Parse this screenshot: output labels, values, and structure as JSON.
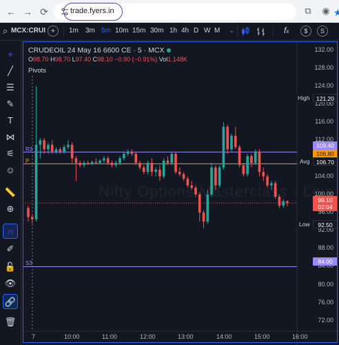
{
  "browser": {
    "back_glyph": "←",
    "forward_glyph": "→",
    "reload_glyph": "⟳",
    "url": "trade.fyers.in",
    "bookmark_icon": "star-icon",
    "extensions_glyph": "⧉",
    "profile_glyph": "◉"
  },
  "toolbar": {
    "search_glyph": "⌕",
    "symbol": "MCX:CRUI",
    "add_glyph": "+",
    "timeframes": [
      "1m",
      "3m",
      "5m",
      "10m",
      "15m",
      "30m",
      "1h",
      "4h",
      "D",
      "W",
      "M"
    ],
    "active_timeframe": "5m",
    "more_glyph": "⌄",
    "indicators_glyph": "f",
    "indicators_label": "x",
    "currency_glyph": "$",
    "settings_glyph": "S"
  },
  "sidebar": {
    "tools": [
      {
        "name": "crosshair-icon",
        "glyph": "+"
      },
      {
        "name": "trendline-icon",
        "glyph": "╱"
      },
      {
        "name": "horizontal-lines-icon",
        "glyph": "☰"
      },
      {
        "name": "brush-icon",
        "glyph": "✎"
      },
      {
        "name": "text-icon",
        "glyph": "T"
      },
      {
        "name": "pattern-icon",
        "glyph": "⋈"
      },
      {
        "name": "prediction-icon",
        "glyph": "⚟"
      },
      {
        "name": "emoji-icon",
        "glyph": "☺"
      },
      {
        "name": "ruler-icon",
        "glyph": "📏"
      },
      {
        "name": "zoom-in-icon",
        "glyph": "⊕"
      },
      {
        "name": "magnet-icon",
        "glyph": "∩"
      },
      {
        "name": "pencil-lock-icon",
        "glyph": "✐"
      },
      {
        "name": "lock-icon",
        "glyph": "🔓"
      },
      {
        "name": "eye-icon",
        "glyph": "👁"
      },
      {
        "name": "link-icon",
        "glyph": "🔗"
      },
      {
        "name": "trash-icon",
        "glyph": "🗑"
      }
    ]
  },
  "chart": {
    "symbol_line": "CRUDEOIL 24 May 16 6600 CE · 5 · MCX",
    "open_label": "O",
    "open": "98.70",
    "high_label": "H",
    "high": "98.70",
    "low_label": "L",
    "low": "97.40",
    "close_label": "C",
    "close": "98.10",
    "change": "−0.90 (−0.91%)",
    "vol_label": "Vol",
    "vol": "1.148K",
    "indicator": "Pivots",
    "watermark": "Nifty Options Masterclass  ·  Live",
    "last_price": "98.10",
    "countdown": "02:04",
    "colors": {
      "up": "#26a69a",
      "down": "#ef5350",
      "pivot_r3": "#9c88ff",
      "pivot_p": "#ff9800",
      "accent": "#2962ff"
    },
    "pivot_r3_label": "R3",
    "pivot_p_label": "P",
    "pivot_s3_label": "S3",
    "levels": {
      "high_label": "High",
      "high_value": "121.20",
      "r3_value": "109.40",
      "p_value": "106.80",
      "avg_label": "Avg",
      "avg_value": "106.70",
      "low_label": "Low",
      "low_value": "92.50",
      "s3_value": "84.00"
    },
    "price_ticks": [
      "132.00",
      "128.00",
      "124.00",
      "120.00",
      "116.00",
      "112.00",
      "108.00",
      "104.00",
      "100.00",
      "96.00",
      "92.00",
      "88.00",
      "84.00",
      "80.00",
      "76.00",
      "72.00"
    ],
    "time_ticks": [
      "7",
      "10:00",
      "11:00",
      "12:00",
      "13:00",
      "14:00",
      "15:00",
      "16:00"
    ]
  },
  "chart_data": {
    "type": "candlestick",
    "y_range": [
      70,
      133
    ],
    "candles": [
      [
        97.0,
        97.5,
        94.0,
        95.0
      ],
      [
        95.0,
        95.5,
        93.5,
        94.5
      ],
      [
        94.5,
        124.0,
        94.0,
        111.0
      ],
      [
        111.0,
        112.5,
        108.0,
        112.0
      ],
      [
        112.0,
        112.5,
        109.0,
        110.0
      ],
      [
        110.0,
        111.5,
        109.0,
        111.0
      ],
      [
        111.0,
        112.0,
        109.0,
        109.5
      ],
      [
        109.5,
        110.5,
        109.0,
        110.0
      ],
      [
        110.0,
        110.5,
        109.0,
        109.5
      ],
      [
        109.5,
        111.0,
        109.0,
        110.5
      ],
      [
        110.5,
        112.0,
        110.0,
        111.0
      ],
      [
        111.0,
        111.5,
        107.0,
        108.0
      ],
      [
        108.0,
        108.5,
        103.0,
        107.0
      ],
      [
        107.0,
        107.5,
        106.0,
        106.5
      ],
      [
        106.5,
        107.5,
        106.0,
        107.0
      ],
      [
        107.0,
        107.5,
        106.5,
        106.8
      ],
      [
        106.8,
        107.5,
        106.5,
        107.2
      ],
      [
        107.2,
        108.0,
        106.8,
        107.0
      ],
      [
        107.0,
        107.8,
        106.8,
        107.5
      ],
      [
        107.5,
        108.5,
        107.0,
        108.0
      ],
      [
        108.0,
        108.5,
        106.5,
        107.0
      ],
      [
        107.0,
        107.5,
        106.0,
        106.5
      ],
      [
        106.5,
        107.5,
        106.0,
        107.0
      ],
      [
        107.0,
        108.5,
        106.5,
        108.0
      ],
      [
        108.0,
        109.5,
        107.5,
        109.0
      ],
      [
        109.0,
        110.0,
        108.5,
        109.5
      ],
      [
        109.5,
        110.0,
        108.5,
        109.0
      ],
      [
        109.0,
        109.5,
        106.5,
        107.0
      ],
      [
        107.0,
        107.5,
        105.5,
        106.0
      ],
      [
        106.0,
        106.5,
        104.5,
        105.0
      ],
      [
        105.0,
        107.5,
        104.5,
        107.0
      ],
      [
        107.0,
        108.0,
        104.0,
        105.0
      ],
      [
        105.0,
        106.0,
        104.0,
        105.5
      ],
      [
        105.5,
        106.5,
        103.0,
        104.0
      ],
      [
        104.0,
        108.0,
        103.5,
        107.5
      ],
      [
        107.5,
        108.5,
        106.5,
        107.0
      ],
      [
        107.0,
        109.5,
        106.5,
        109.0
      ],
      [
        109.0,
        109.5,
        104.5,
        105.0
      ],
      [
        105.0,
        106.0,
        104.0,
        104.5
      ],
      [
        104.5,
        105.0,
        103.0,
        103.5
      ],
      [
        103.5,
        104.0,
        101.5,
        102.0
      ],
      [
        102.0,
        103.0,
        101.0,
        101.5
      ],
      [
        101.5,
        102.0,
        99.5,
        100.0
      ],
      [
        100.0,
        100.5,
        94.0,
        96.0
      ],
      [
        96.0,
        96.5,
        92.5,
        94.0
      ],
      [
        94.0,
        101.0,
        93.5,
        100.0
      ],
      [
        100.0,
        107.0,
        99.5,
        106.0
      ],
      [
        106.0,
        106.5,
        101.0,
        102.0
      ],
      [
        102.0,
        106.5,
        101.5,
        106.0
      ],
      [
        106.0,
        116.0,
        105.5,
        115.0
      ],
      [
        115.0,
        115.5,
        109.0,
        110.0
      ],
      [
        110.0,
        113.5,
        109.5,
        113.0
      ],
      [
        113.0,
        115.0,
        110.0,
        110.5
      ],
      [
        110.5,
        111.0,
        106.0,
        106.5
      ],
      [
        106.5,
        107.0,
        104.0,
        104.5
      ],
      [
        104.5,
        109.0,
        104.0,
        108.5
      ],
      [
        108.5,
        109.0,
        106.0,
        107.0
      ],
      [
        107.0,
        110.0,
        106.5,
        109.5
      ],
      [
        109.5,
        110.0,
        104.0,
        105.0
      ],
      [
        105.0,
        106.0,
        103.0,
        104.0
      ],
      [
        104.0,
        104.5,
        101.5,
        102.0
      ],
      [
        102.0,
        103.0,
        101.0,
        102.5
      ],
      [
        102.5,
        103.0,
        99.0,
        99.5
      ],
      [
        99.5,
        100.0,
        97.0,
        97.5
      ],
      [
        97.5,
        99.0,
        97.0,
        98.5
      ],
      [
        98.5,
        98.7,
        97.4,
        98.1
      ]
    ]
  }
}
